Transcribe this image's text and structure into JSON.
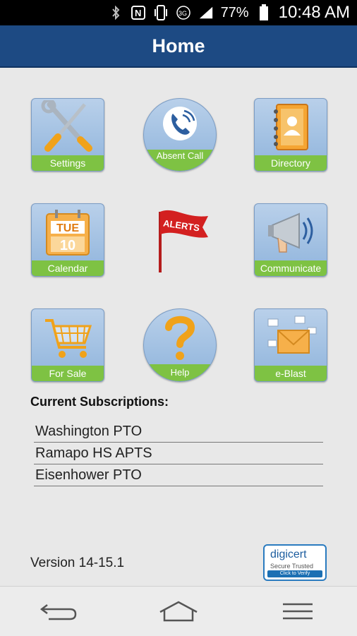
{
  "status_bar": {
    "battery_percent": "77%",
    "time": "10:48 AM",
    "icons": [
      "bluetooth-icon",
      "nfc-icon",
      "vibrate-icon",
      "3g-icon",
      "signal-icon",
      "battery-icon"
    ]
  },
  "header": {
    "title": "Home"
  },
  "tiles": [
    {
      "label": "Settings",
      "icon": "tools-icon"
    },
    {
      "label": "Absent Call",
      "icon": "phone-icon"
    },
    {
      "label": "Directory",
      "icon": "address-book-icon"
    },
    {
      "label": "Calendar",
      "icon": "calendar-icon",
      "day": "TUE",
      "date": "10"
    },
    {
      "label": "ALERTS",
      "icon": "alerts-flag-icon"
    },
    {
      "label": "Communicate",
      "icon": "megaphone-icon"
    },
    {
      "label": "For Sale",
      "icon": "cart-icon"
    },
    {
      "label": "Help",
      "icon": "question-icon"
    },
    {
      "label": "e-Blast",
      "icon": "envelope-icon"
    }
  ],
  "subscriptions": {
    "title": "Current Subscriptions:",
    "items": [
      "Washington PTO",
      "Ramapo HS APTS",
      "Eisenhower PTO"
    ]
  },
  "footer": {
    "version": "Version 14-15.1",
    "badge": {
      "brand": "digicert",
      "tagline": "Secure Trusted",
      "verify": "Click to Verify"
    }
  },
  "nav": {
    "icons": [
      "back-icon",
      "home-icon",
      "menu-icon"
    ]
  },
  "colors": {
    "header": "#1d4a83",
    "label_green": "#7ec243",
    "tile_blue": "#a6c3e4"
  }
}
